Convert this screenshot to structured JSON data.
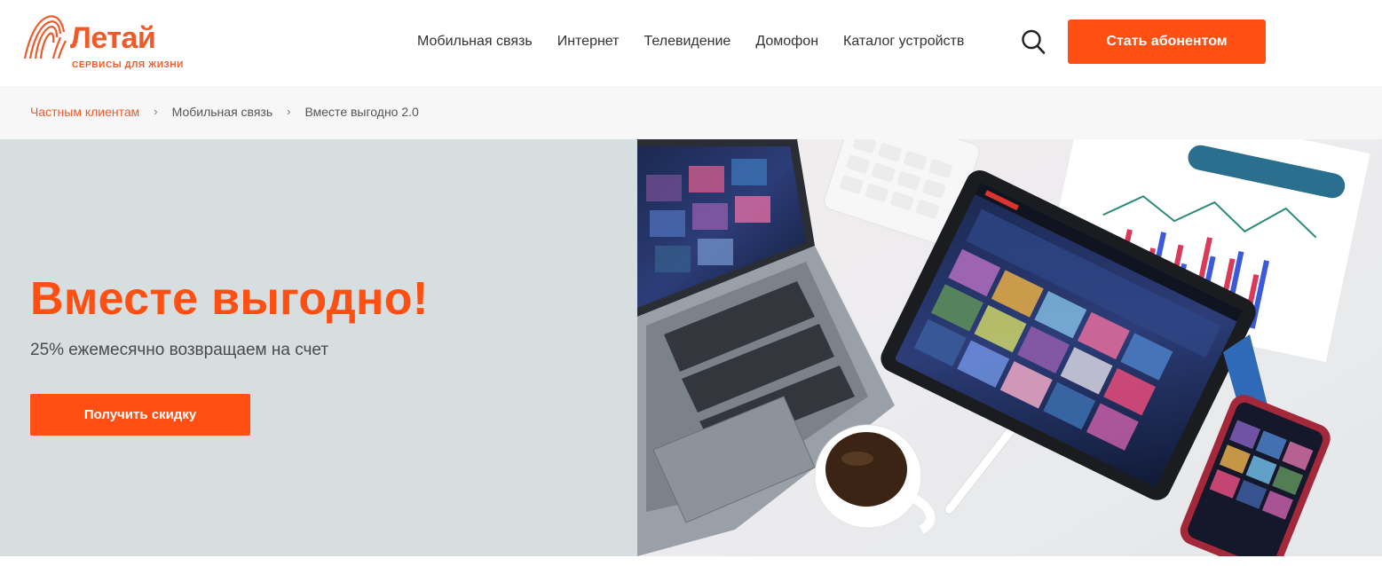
{
  "brand": {
    "name": "Летай",
    "tagline": "сервисы для жизни",
    "color": "#ef5a2b"
  },
  "nav": {
    "items": [
      {
        "label": "Мобильная связь"
      },
      {
        "label": "Интернет"
      },
      {
        "label": "Телевидение"
      },
      {
        "label": "Домофон"
      },
      {
        "label": "Каталог устройств"
      }
    ],
    "search_icon": "search-icon",
    "cta_label": "Стать абонентом"
  },
  "breadcrumbs": [
    {
      "label": "Частным клиентам"
    },
    {
      "label": "Мобильная связь"
    },
    {
      "label": "Вместе выгодно 2.0"
    }
  ],
  "hero": {
    "title": "Вместе выгодно!",
    "subtitle": "25% ежемесячно возвращаем на счет",
    "button_label": "Получить скидку",
    "background": "#d7dedf",
    "accent": "#ff4f12"
  }
}
